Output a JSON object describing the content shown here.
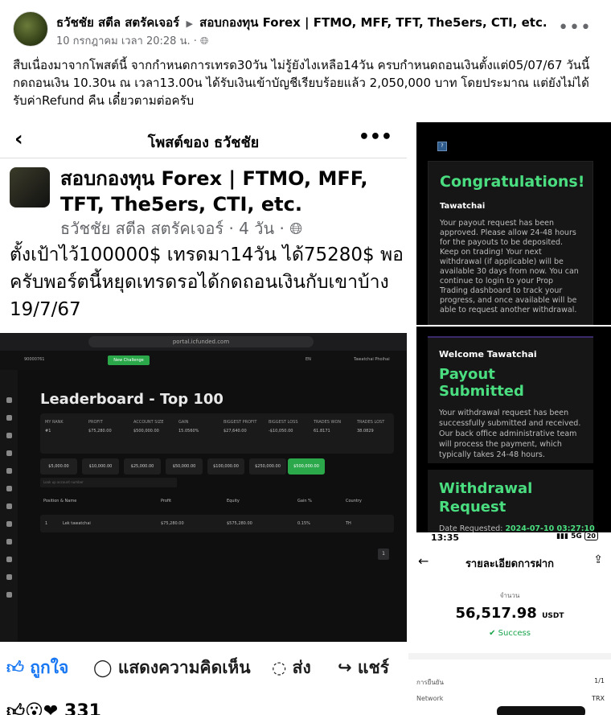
{
  "post": {
    "author": "ธวัชชัย สตีล สตรัคเจอร์",
    "group": "สอบกองทุน Forex | FTMO, MFF, TFT, The5ers, CTI, etc.",
    "timestamp": "10 กรกฎาคม เวลา 20:28 น.",
    "privacy_icon": "globe-icon",
    "more": "•••",
    "text": "สืบเนื่องมาจากโพสต์นี้ จากกำหนดการเทรด30วัน ไม่รู้ยังไงเหลือ14วัน ครบกำหนดถอนเงินตั้งแต่05/07/67 วันนี้กดถอนเงิน 10.30น ณ เวลา13.00น ได้รับเงินเข้าบัญชีเรียบร้อยแล้ว 2,050,000 บาท โดยประมาณ แต่ยังไม่ได้รับค่าRefund คืน เดี๋ยวตามต่อครับ"
  },
  "shared_post": {
    "header_title": "โพสต์ของ ธวัชชัย",
    "group": "สอบกองทุน Forex | FTMO, MFF, TFT, The5ers, CTI, etc.",
    "meta": "ธวัชชัย สตีล สตรัคเจอร์ · 4 วัน ·",
    "text": "ตั้งเป้าไว้100000$ เทรดมา14วัน ได้75280$ พอครับพอร์ตนี้หยุดเทรดรอได้กดถอนเงินกับเขาบ้าง 19/7/67",
    "actions": {
      "like": "ถูกใจ",
      "comment": "แสดงความคิดเห็น",
      "share_messenger": "ส่ง",
      "share": "แชร์"
    },
    "reaction_count": "331"
  },
  "dashboard": {
    "url": "portal.icfunded.com",
    "nav_button": "New Challenge",
    "lang": "EN",
    "account_id": "90000761",
    "user_name": "Tawatchai Phoihai",
    "title": "Leaderboard - Top 100",
    "stats": [
      {
        "label": "MY RANK",
        "value": "#1"
      },
      {
        "label": "PROFIT",
        "value": "$75,280.00"
      },
      {
        "label": "ACCOUNT SIZE",
        "value": "$500,000.00"
      },
      {
        "label": "GAIN",
        "value": "15.0560%"
      },
      {
        "label": "BIGGEST PROFIT",
        "value": "$27,640.00"
      },
      {
        "label": "BIGGEST LOSS",
        "value": "-$10,050.00"
      },
      {
        "label": "TRADES WON",
        "value": "61.8171"
      },
      {
        "label": "TRADES LOST",
        "value": "38.0829"
      }
    ],
    "chips": [
      "$5,000.00",
      "$10,000.00",
      "$25,000.00",
      "$50,000.00",
      "$100,000.00",
      "$250,000.00",
      "$500,000.00"
    ],
    "search_placeholder": "Look up account number",
    "table_headers": [
      "Position & Name",
      "Profit",
      "Equity",
      "Gain %",
      "Country"
    ],
    "row": {
      "pos": "1",
      "name": "Lek tawatchai",
      "profit": "$75,280.00",
      "equity": "$575,280.00",
      "gain": "0.15%",
      "country": "TH"
    },
    "page": "1"
  },
  "congrats": {
    "title": "Congratulations!",
    "name": "Tawatchai",
    "body": "Your payout request has been approved. Please allow 24-48 hours for the payouts to be deposited. Keep on trading! Your next withdrawal (if applicable) will be available 30 days from now. You can continue to login to your Prop Trading dashboard to track your progress, and once available will be able to request another withdrawal."
  },
  "payout": {
    "welcome": "Welcome Tawatchai",
    "title": "Payout Submitted",
    "body": "Your withdrawal request has been successfully submitted and received. Our back office administrative team will process the payment, which typically takes 24-48 hours.",
    "withdrawal_title": "Withdrawal Request",
    "date_label": "Date Requested:",
    "date_value": "2024-07-10 03:27:10"
  },
  "phone": {
    "time": "13:35",
    "signal": "5G",
    "battery": "20",
    "title": "รายละเอียดการฝาก",
    "amount_label": "จำนวน",
    "amount": "56,517.98",
    "currency": "USDT",
    "status": "Success",
    "confirm_label": "การยืนยัน",
    "confirm_value": "1/1",
    "network_label": "Network",
    "network_value": "TRX"
  }
}
